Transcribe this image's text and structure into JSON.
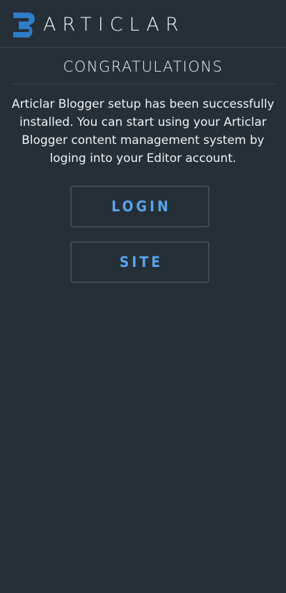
{
  "brand": {
    "name": "ARTICLAR",
    "logo_icon": "articlar-b-logo-icon",
    "accent_color": "#2e7dc9"
  },
  "setup": {
    "title": "CONGRATULATIONS",
    "message": "Articlar Blogger setup has been successfully installed. You can start using your Articlar Blogger content management system by loging into your Editor account."
  },
  "actions": {
    "login_label": "LOGIN",
    "site_label": "SITE",
    "link_color": "#58a4ea"
  }
}
